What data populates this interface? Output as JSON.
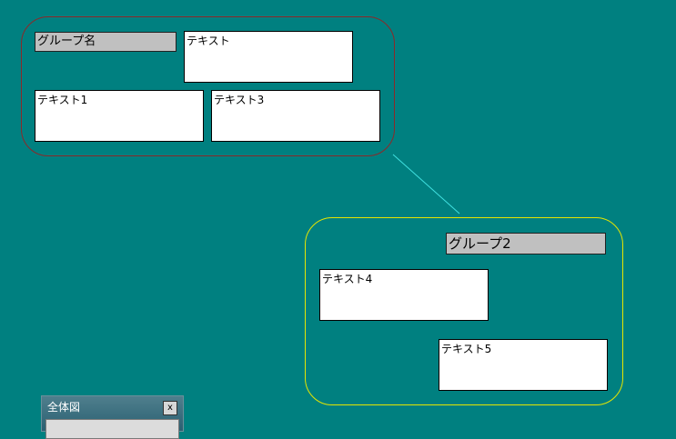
{
  "groups": [
    {
      "name": "グループ名",
      "boxes": [
        "テキスト",
        "テキスト1",
        "テキスト3"
      ]
    },
    {
      "name": "グループ2",
      "boxes": [
        "テキスト4",
        "テキスト5"
      ]
    }
  ],
  "overview": {
    "title": "全体図",
    "close_label": "x"
  },
  "colors": {
    "background": "#008080",
    "group1_border": "#8a2a2a",
    "group2_border": "#e6e600",
    "connector": "#40e0e0"
  }
}
